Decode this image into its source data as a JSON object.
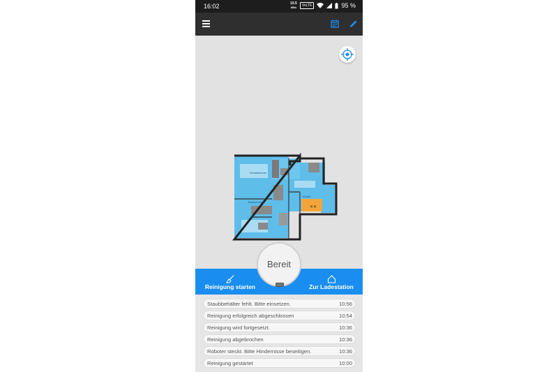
{
  "status_bar": {
    "time": "16:02",
    "net_speed": "10.5",
    "net_unit": "kB/s",
    "volte": "VoLTE",
    "battery": "95 %"
  },
  "app_bar": {
    "menu_icon": "hamburger-icon",
    "calendar_icon": "calendar-icon",
    "edit_icon": "pencil-icon"
  },
  "map": {
    "room_labels": [
      "Schlafzimmer",
      "Badezimmer",
      "Küche"
    ]
  },
  "status": {
    "label": "Bereit"
  },
  "actions": {
    "start_label": "Reinigung starten",
    "dock_label": "Zur Ladestation"
  },
  "colors": {
    "accent": "#1a8ef0",
    "appbar": "#2f2f2f",
    "map_floor": "#55b8ea",
    "dock_highlight": "#f4a53a"
  },
  "log": [
    {
      "message": "Staubbehälter fehlt. Bitte einsetzen.",
      "time": "10:56"
    },
    {
      "message": "Reinigung erfolgreich abgeschlossen",
      "time": "10:54"
    },
    {
      "message": "Reinigung wird fortgesetzt.",
      "time": "10:36"
    },
    {
      "message": "Reinigung abgebrochen",
      "time": "10:36"
    },
    {
      "message": "Roboter steckt. Bitte Hindernisse beseitigen.",
      "time": "10:36"
    },
    {
      "message": "Reinigung gestartet",
      "time": "10:00"
    }
  ]
}
